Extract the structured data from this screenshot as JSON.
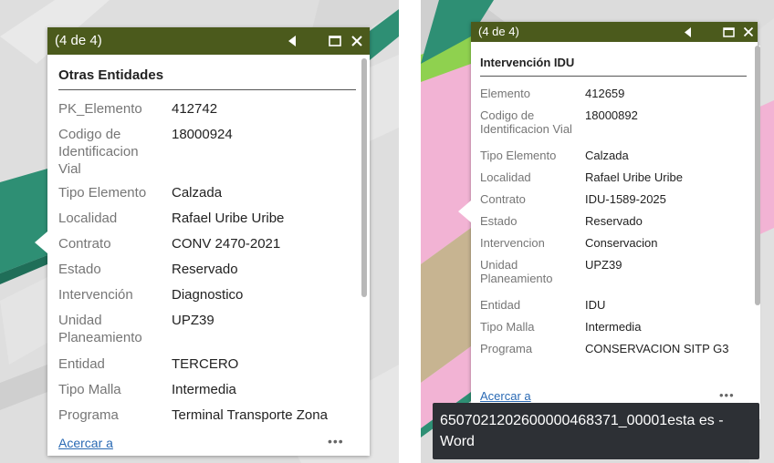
{
  "left_popup": {
    "counter": "(4 de 4)",
    "heading": "Otras Entidades",
    "fields": [
      {
        "label": "PK_Elemento",
        "value": "412742"
      },
      {
        "label": "Codigo de Identificacion Vial",
        "value": "18000924"
      },
      {
        "label": "Tipo Elemento",
        "value": "Calzada"
      },
      {
        "label": "Localidad",
        "value": "Rafael Uribe Uribe"
      },
      {
        "label": "Contrato",
        "value": "CONV 2470-2021"
      },
      {
        "label": "Estado",
        "value": "Reservado"
      },
      {
        "label": "Intervención",
        "value": "Diagnostico"
      },
      {
        "label": "Unidad Planeamiento",
        "value": "UPZ39"
      },
      {
        "label": "Entidad",
        "value": "TERCERO"
      },
      {
        "label": "Tipo Malla",
        "value": "Intermedia"
      },
      {
        "label": "Programa",
        "value": "Terminal Transporte Zona"
      }
    ],
    "zoom_link": "Acercar a",
    "more": "•••"
  },
  "right_popup": {
    "counter": "(4 de 4)",
    "heading": "Intervención IDU",
    "fields": [
      {
        "label": "Elemento",
        "value": "412659"
      },
      {
        "label": "Codigo de Identificacion Vial",
        "value": "18000892"
      },
      {
        "label": "Tipo Elemento",
        "value": "Calzada"
      },
      {
        "label": "Localidad",
        "value": "Rafael Uribe Uribe"
      },
      {
        "label": "Contrato",
        "value": "IDU-1589-2025"
      },
      {
        "label": "Estado",
        "value": "Reservado"
      },
      {
        "label": "Intervencion",
        "value": "Conservacion"
      },
      {
        "label": "Unidad Planeamiento",
        "value": "UPZ39"
      },
      {
        "label": "Entidad",
        "value": "IDU"
      },
      {
        "label": "Tipo Malla",
        "value": "Intermedia"
      },
      {
        "label": "Programa",
        "value": "CONSERVACION SITP G3"
      }
    ],
    "zoom_link": "Acercar a",
    "more": "•••"
  },
  "tooltip": {
    "text": "650702120260000046837​1_00001esta es - Word"
  },
  "colors": {
    "title_bar": "#4b5a1c",
    "road_green": "#2e8f74",
    "parcel_pink": "#f2b3d4",
    "parcel_tan": "#c7b491",
    "lawn_green": "#8fd14f",
    "link_blue": "#2a6ab4"
  },
  "icons": {
    "prev": "triangle-left-icon",
    "maximize": "maximize-icon",
    "close": "close-icon"
  }
}
